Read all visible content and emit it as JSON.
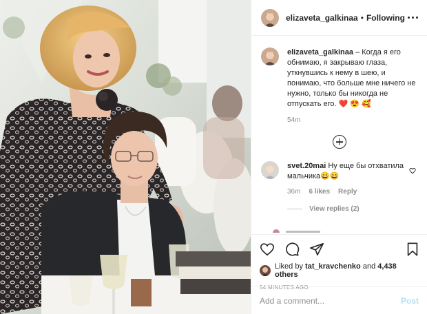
{
  "post": {
    "image_alt": "",
    "author": "elizaveta_galkinaa",
    "separator": "•",
    "follow_status": "Following"
  },
  "caption": {
    "username": "elizaveta_galkinaa",
    "text": "– Когда я его обнимаю, я закрываю глаза, уткнувшись к нему в шею, и понимаю, что больше мне ничего не нужно, только бы никогда не отпускать его. ❤️ 😍 🥰",
    "age": "54m"
  },
  "comment": {
    "username": "svet.20mai",
    "text": "Ну еще бы отхватила мальчика😄😄",
    "age": "36m",
    "likes": "6 likes",
    "reply": "Reply",
    "view_replies": "View replies (2)"
  },
  "likes": {
    "prefix": "Liked by",
    "user": "tat_kravchenko",
    "middle": "and",
    "count": "4,438 others"
  },
  "timestamp": "54 MINUTES AGO",
  "add_comment": {
    "placeholder": "Add a comment...",
    "post_label": "Post"
  },
  "icons": {
    "like": "heart-icon",
    "comment": "comment-icon",
    "share": "share-icon",
    "save": "bookmark-icon",
    "more": "more-options-icon",
    "load_more": "plus-circle-icon"
  },
  "colors": {
    "text": "#262626",
    "muted": "#8e8e8e",
    "border": "#efefef",
    "post_button": "#b2dffc"
  }
}
